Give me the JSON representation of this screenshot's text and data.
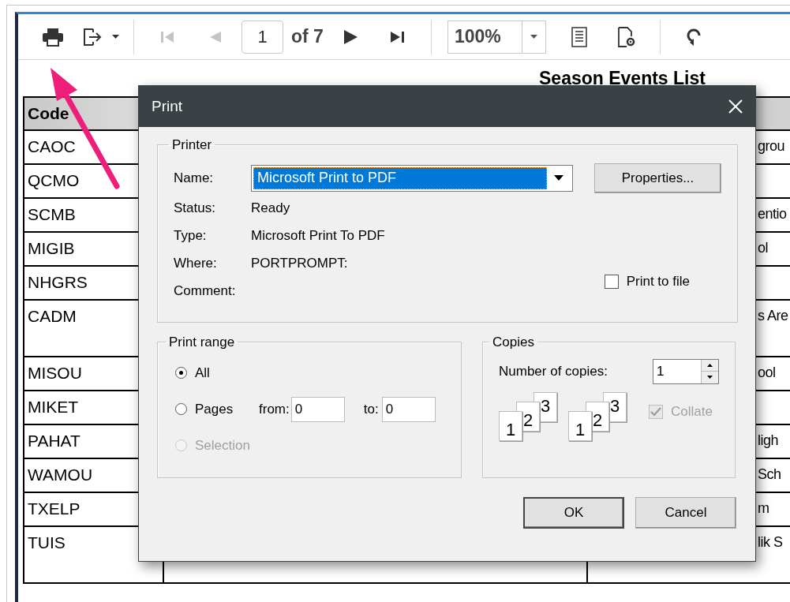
{
  "toolbar": {
    "tools": [
      {
        "kind": "print",
        "disabled": false
      },
      {
        "kind": "export",
        "disabled": false
      },
      {
        "kind": "separator"
      },
      {
        "kind": "first",
        "disabled": true
      },
      {
        "kind": "prev",
        "disabled": true
      },
      {
        "kind": "page"
      },
      {
        "kind": "next",
        "disabled": false
      },
      {
        "kind": "last",
        "disabled": false
      },
      {
        "kind": "separator"
      },
      {
        "kind": "zoom"
      },
      {
        "kind": "docmap",
        "disabled": false
      },
      {
        "kind": "pagesetup",
        "disabled": false
      },
      {
        "kind": "separator"
      },
      {
        "kind": "refresh",
        "disabled": false
      }
    ],
    "page_value": "1",
    "page_count": "of 7",
    "zoom_value": "100%"
  },
  "report": {
    "title": "Season Events List",
    "columns": [
      {
        "label": "Code"
      }
    ],
    "rows": [
      {
        "code": "CAOC",
        "column_3": "grou",
        "tall": false
      },
      {
        "code": "QCMO",
        "column_3": "",
        "tall": false
      },
      {
        "code": "SCMB",
        "column_3": "entio",
        "tall": false
      },
      {
        "code": "MIGIB",
        "column_3": "ol",
        "tall": false
      },
      {
        "code": "NHGRS",
        "column_3": "",
        "tall": false
      },
      {
        "code": "CADM",
        "column_3": "s Are",
        "tall": true
      },
      {
        "code": "MISOU",
        "column_3": "ool",
        "tall": false
      },
      {
        "code": "MIKET",
        "column_3": "",
        "tall": false
      },
      {
        "code": "PAHAT",
        "column_3": "ligh",
        "tall": false
      },
      {
        "code": "WAMOU",
        "column_3": "Sch",
        "tall": false
      },
      {
        "code": "TXELP",
        "column_3": "m",
        "tall": false
      },
      {
        "code": "TUIS",
        "column_3": "lik S",
        "tall": true
      }
    ]
  },
  "dialog": {
    "title": "Print",
    "printer": {
      "label": "Printer",
      "name_label": "Name:",
      "name_value": "Microsoft Print to PDF",
      "properties": "Properties...",
      "info": [
        {
          "label": "Status:",
          "value": "Ready"
        },
        {
          "label": "Type:",
          "value": "Microsoft Print To PDF"
        },
        {
          "label": "Where:",
          "value": "PORTPROMPT:"
        },
        {
          "label": "Comment:"
        }
      ],
      "print_to_file": {
        "label": "Print to file",
        "checked": false
      }
    },
    "print_range": {
      "label": "Print range",
      "options": [
        {
          "label": "All",
          "selected": true,
          "disabled": false
        },
        {
          "label": "Pages",
          "selected": false,
          "disabled": false
        },
        {
          "label": "Selection",
          "selected": false,
          "disabled": true
        }
      ],
      "from_label": "from:",
      "from_value": "0",
      "to_label": "to:",
      "to_value": "0"
    },
    "copies": {
      "label": "Copies",
      "number_label": "Number of copies:",
      "number_value": "1",
      "stacks": [
        [
          "1",
          "2",
          "3"
        ],
        [
          "1",
          "2",
          "3"
        ]
      ],
      "collate": {
        "label": "Collate",
        "checked": true,
        "disabled": true
      }
    },
    "buttons": [
      "OK",
      "Cancel"
    ]
  }
}
